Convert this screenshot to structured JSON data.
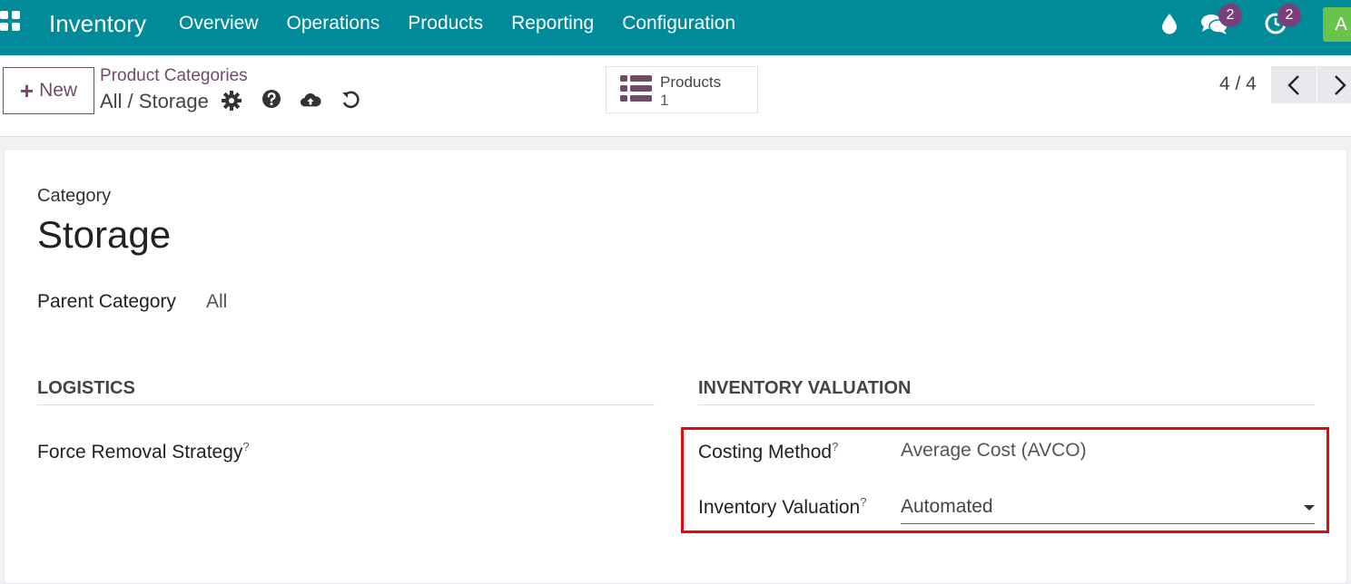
{
  "navbar": {
    "app_title": "Inventory",
    "menu": [
      "Overview",
      "Operations",
      "Products",
      "Reporting",
      "Configuration"
    ],
    "messages_badge": "2",
    "activities_badge": "2",
    "avatar_initial": "A",
    "bg_color": "#018b9a"
  },
  "control": {
    "new_label": "New",
    "breadcrumb_parent": "Product Categories",
    "breadcrumb_current": "All / Storage",
    "smart_button": {
      "label": "Products",
      "count": "1"
    },
    "pager": "4 / 4"
  },
  "form": {
    "category_label": "Category",
    "category_name": "Storage",
    "parent_category_label": "Parent Category",
    "parent_category_value": "All",
    "logistics_title": "LOGISTICS",
    "force_removal_label": "Force Removal Strategy",
    "valuation_title": "INVENTORY VALUATION",
    "costing_method_label": "Costing Method",
    "costing_method_value": "Average Cost (AVCO)",
    "inventory_valuation_label": "Inventory Valuation",
    "inventory_valuation_value": "Automated",
    "help_mark": "?"
  },
  "accent_color": "#714b67",
  "highlight_color": "#e00b0b"
}
